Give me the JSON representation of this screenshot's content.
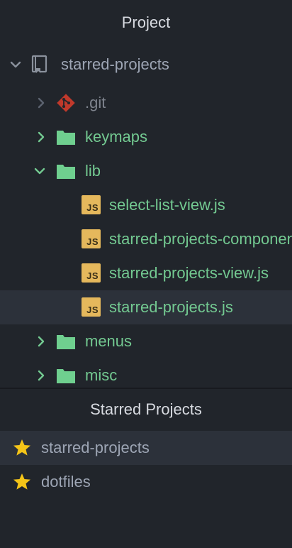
{
  "project_panel": {
    "title": "Project",
    "root": {
      "label": "starred-projects",
      "expanded": true,
      "icon": "repo-icon"
    },
    "items": [
      {
        "label": ".git",
        "type": "git-folder",
        "expanded": false,
        "icon": "git-icon"
      },
      {
        "label": "keymaps",
        "type": "folder",
        "expanded": false,
        "icon": "folder-icon"
      },
      {
        "label": "lib",
        "type": "folder",
        "expanded": true,
        "icon": "folder-icon"
      },
      {
        "label": "select-list-view.js",
        "type": "js-file",
        "icon": "js-file-icon"
      },
      {
        "label": "starred-projects-component.js",
        "type": "js-file",
        "icon": "js-file-icon"
      },
      {
        "label": "starred-projects-view.js",
        "type": "js-file",
        "icon": "js-file-icon"
      },
      {
        "label": "starred-projects.js",
        "type": "js-file",
        "selected": true,
        "icon": "js-file-icon"
      },
      {
        "label": "menus",
        "type": "folder",
        "expanded": false,
        "icon": "folder-icon"
      },
      {
        "label": "misc",
        "type": "folder",
        "expanded": false,
        "icon": "folder-icon"
      }
    ],
    "js_badge_text": "JS"
  },
  "starred_panel": {
    "title": "Starred Projects",
    "items": [
      {
        "label": "starred-projects",
        "active": true,
        "icon": "star-icon"
      },
      {
        "label": "dotfiles",
        "active": false,
        "icon": "star-icon"
      }
    ]
  },
  "colors": {
    "background": "#21252b",
    "selected_row": "#2c313a",
    "text": "#9da5b4",
    "git_status_green": "#73c991",
    "folder": "#6fcf8f",
    "js_badge": "#e5b85c",
    "git_icon": "#c0392b",
    "star": "#f5c518"
  }
}
